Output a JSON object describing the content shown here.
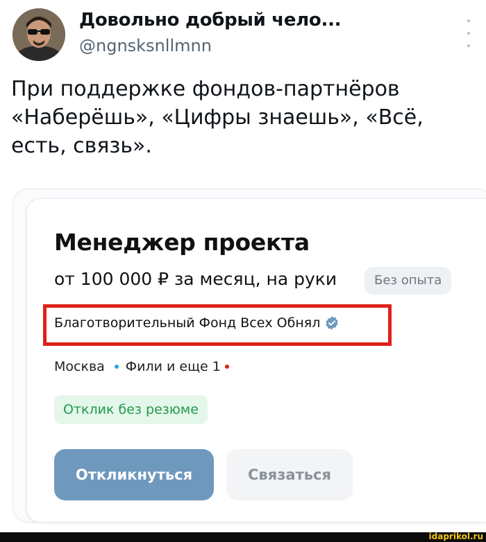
{
  "tweet": {
    "author_name": "Довольно добрый чело...",
    "author_handle": "@ngnsksnllmnn",
    "text": "При поддержке фондов-партнёров\n«Наберёшь», «Цифры знаешь», «Всё,\nесть, связь»."
  },
  "vacancy": {
    "title": "Менеджер проекта",
    "salary": "от 100 000 ₽ за месяц, на руки",
    "experience_badge": "Без опыта",
    "company": "Благотворительный Фонд Всех Обнял",
    "city": "Москва",
    "metro": "Фили и еще 1",
    "no_resume_tag": "Отклик без резюме",
    "respond_button": "Откликнуться",
    "contact_button": "Связаться"
  },
  "colors": {
    "highlight": "#e0201a",
    "metro_blue": "#2aa7de",
    "metro_red": "#e0201a",
    "respond_bg": "#6f98bd",
    "no_resume_green": "#1f9c4b"
  },
  "watermark": "idaprikol.ru"
}
